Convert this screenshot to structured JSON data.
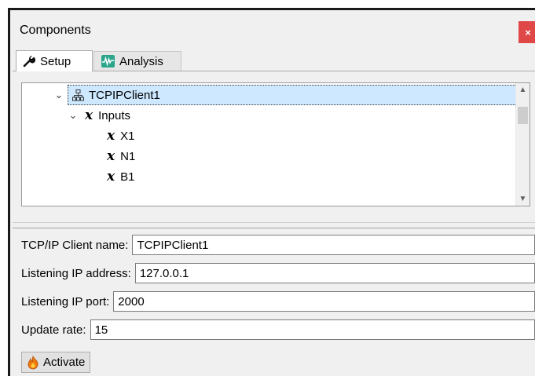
{
  "window": {
    "title": "Components",
    "close_label": "×"
  },
  "tabs": [
    {
      "label": "Setup",
      "icon": "wrench-icon",
      "active": true
    },
    {
      "label": "Analysis",
      "icon": "waveform-icon",
      "active": false
    }
  ],
  "tree": {
    "root": {
      "label": "TCPIPClient1",
      "icon": "network-icon",
      "expanded": true,
      "selected": true
    },
    "group": {
      "label": "Inputs",
      "symbol": "x",
      "expanded": true
    },
    "items": [
      {
        "label": "X1",
        "symbol": "x"
      },
      {
        "label": "N1",
        "symbol": "x"
      },
      {
        "label": "B1",
        "symbol": "x"
      }
    ]
  },
  "form": {
    "client_name": {
      "label": "TCP/IP Client name:",
      "value": "TCPIPClient1"
    },
    "ip_address": {
      "label": "Listening IP address:",
      "value": "127.0.0.1"
    },
    "ip_port": {
      "label": "Listening IP port:",
      "value": "2000"
    },
    "update_rate": {
      "label": "Update rate:",
      "value": "15"
    }
  },
  "activate_button": {
    "label": "Activate",
    "icon": "flame-icon"
  },
  "colors": {
    "selection": "#cde8ff",
    "close": "#e04848",
    "panel": "#f0f0f0"
  }
}
